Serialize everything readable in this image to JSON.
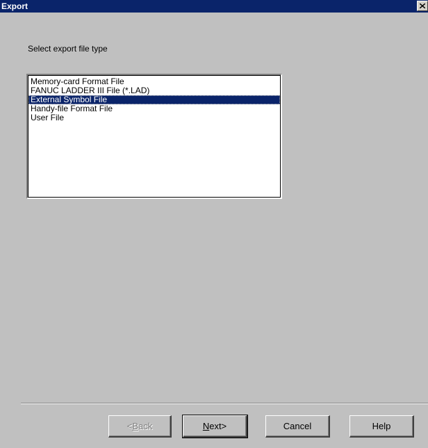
{
  "window": {
    "title": "Export",
    "close_icon": "close-icon"
  },
  "prompt": "Select export file type",
  "file_types": [
    {
      "label": "Memory-card Format File",
      "selected": false
    },
    {
      "label": "FANUC LADDER III File (*.LAD)",
      "selected": false
    },
    {
      "label": "External Symbol File",
      "selected": true
    },
    {
      "label": "Handy-file Format File",
      "selected": false
    },
    {
      "label": "User File",
      "selected": false
    }
  ],
  "buttons": {
    "back": {
      "prefix": "<",
      "accel": "B",
      "rest": "ack",
      "enabled": false
    },
    "next": {
      "prefix": "",
      "accel": "N",
      "rest": "ext>",
      "enabled": true
    },
    "cancel": {
      "label": "Cancel",
      "enabled": true
    },
    "help": {
      "label": "Help",
      "enabled": true
    }
  },
  "colors": {
    "face": "#c0c0c0",
    "titlebar": "#0a246a",
    "selection": "#0a246a"
  }
}
